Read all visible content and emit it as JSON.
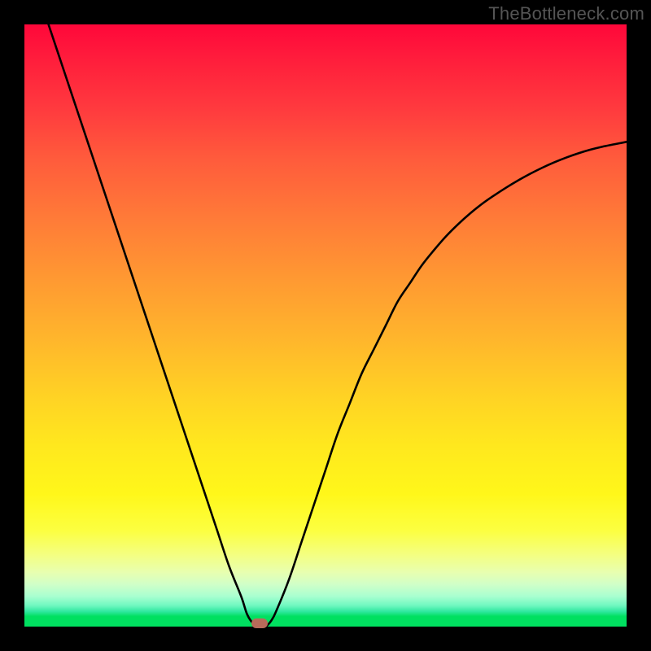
{
  "watermark": "TheBottleneck.com",
  "colors": {
    "frame": "#000000",
    "gradient_top": "#ff073a",
    "gradient_bottom": "#00e060",
    "curve": "#000000",
    "marker": "#b86b5a"
  },
  "chart_data": {
    "type": "line",
    "title": "",
    "xlabel": "",
    "ylabel": "",
    "xlim": [
      0,
      100
    ],
    "ylim": [
      0,
      100
    ],
    "series": [
      {
        "name": "bottleneck-curve",
        "x": [
          4,
          6,
          8,
          10,
          12,
          14,
          16,
          18,
          20,
          22,
          24,
          26,
          28,
          30,
          32,
          34,
          36,
          37,
          38,
          39,
          40,
          41,
          42,
          44,
          46,
          48,
          50,
          52,
          54,
          56,
          58,
          60,
          62,
          64,
          66,
          68,
          70,
          72,
          74,
          76,
          78,
          80,
          82,
          84,
          86,
          88,
          90,
          92,
          94,
          96,
          98,
          100
        ],
        "values": [
          100,
          94,
          88,
          82,
          76,
          70,
          64,
          58,
          52,
          46,
          40,
          34,
          28,
          22,
          16,
          10,
          5,
          2,
          0.5,
          0,
          0,
          1,
          3,
          8,
          14,
          20,
          26,
          32,
          37,
          42,
          46,
          50,
          54,
          57,
          60,
          62.5,
          64.8,
          66.8,
          68.6,
          70.2,
          71.6,
          72.9,
          74.1,
          75.2,
          76.2,
          77.1,
          77.9,
          78.6,
          79.2,
          79.7,
          80.1,
          80.5
        ]
      }
    ],
    "annotations": [
      {
        "name": "min-marker",
        "x": 39,
        "y": 0
      }
    ]
  }
}
